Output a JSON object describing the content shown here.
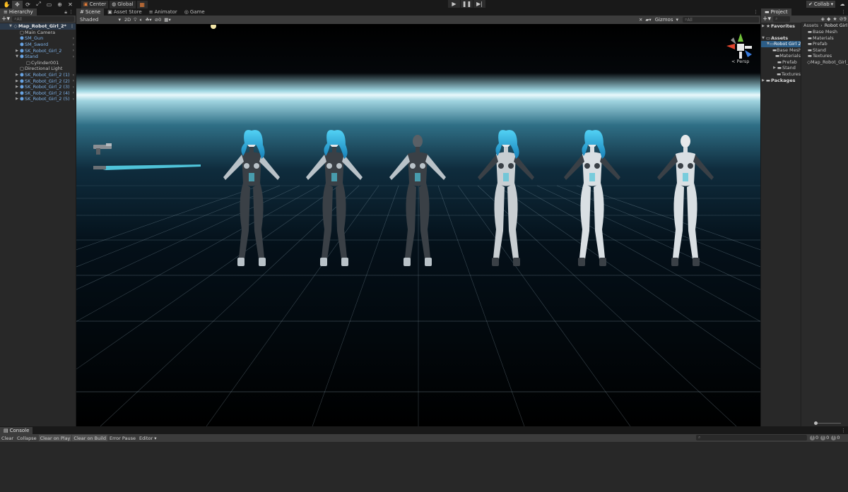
{
  "toolbar": {
    "center_label": "Center",
    "global_label": "Global",
    "collab_label": "Collab"
  },
  "hierarchy": {
    "tab_label": "Hierarchy",
    "search_placeholder": "All",
    "items": [
      {
        "label": "Map_Robot_Girl_2*",
        "depth": 0,
        "arrow": "▼",
        "icon": "scene",
        "prefab": false,
        "more": true,
        "root": true
      },
      {
        "label": "Main Camera",
        "depth": 1,
        "arrow": "",
        "icon": "object",
        "prefab": false,
        "more": false
      },
      {
        "label": "SM_Gun",
        "depth": 1,
        "arrow": "",
        "icon": "prefab",
        "prefab": true,
        "more": true
      },
      {
        "label": "SM_Sword",
        "depth": 1,
        "arrow": "",
        "icon": "prefab",
        "prefab": true,
        "more": true
      },
      {
        "label": "SK_Robot_Girl_2",
        "depth": 1,
        "arrow": "▶",
        "icon": "prefab",
        "prefab": true,
        "more": true
      },
      {
        "label": "Stand",
        "depth": 1,
        "arrow": "▼",
        "icon": "prefab",
        "prefab": true,
        "more": true
      },
      {
        "label": "Cylinder001",
        "depth": 2,
        "arrow": "",
        "icon": "object",
        "prefab": false,
        "more": false
      },
      {
        "label": "Directional Light",
        "depth": 1,
        "arrow": "",
        "icon": "object",
        "prefab": false,
        "more": false
      },
      {
        "label": "SK_Robot_Girl_2 (1)",
        "depth": 1,
        "arrow": "▶",
        "icon": "prefab",
        "prefab": true,
        "more": true
      },
      {
        "label": "SK_Robot_Girl_2 (2)",
        "depth": 1,
        "arrow": "▶",
        "icon": "prefab",
        "prefab": true,
        "more": true
      },
      {
        "label": "SK_Robot_Girl_2 (3)",
        "depth": 1,
        "arrow": "▶",
        "icon": "prefab",
        "prefab": true,
        "more": true
      },
      {
        "label": "SK_Robot_Girl_2 (4)",
        "depth": 1,
        "arrow": "▶",
        "icon": "prefab",
        "prefab": true,
        "more": true
      },
      {
        "label": "SK_Robot_Girl_2 (5)",
        "depth": 1,
        "arrow": "▶",
        "icon": "prefab",
        "prefab": true,
        "more": true
      }
    ]
  },
  "scene": {
    "tabs": [
      {
        "label": "Scene",
        "icon": "#",
        "active": true
      },
      {
        "label": "Asset Store",
        "icon": "▣",
        "active": false
      },
      {
        "label": "Animator",
        "icon": "≡",
        "active": false
      },
      {
        "label": "Game",
        "icon": "◎",
        "active": false
      }
    ],
    "shading_mode": "Shaded",
    "mode_2d": "2D",
    "hidden_count": "0",
    "gizmos_label": "Gizmos",
    "search_placeholder": "All",
    "persp_label": "< Persp",
    "sky_colors": {
      "top": "#000000",
      "horizon": "#cfeef5",
      "glow": "#5fb6c9",
      "floor": "#0a1a24"
    },
    "figures": [
      {
        "hair": "#29b6e6",
        "suit": "dark"
      },
      {
        "hair": "#29b6e6",
        "suit": "dark"
      },
      {
        "hair": "",
        "suit": "dark"
      },
      {
        "hair": "#29b6e6",
        "suit": "mixed"
      },
      {
        "hair": "#29b6e6",
        "suit": "light"
      },
      {
        "hair": "",
        "suit": "light"
      }
    ]
  },
  "project": {
    "tab_label": "Project",
    "favorites_label": "Favorites",
    "assets_label": "Assets",
    "packages_label": "Packages",
    "tree": [
      {
        "label": "Robot Girl 2",
        "depth": 1,
        "arrow": "▼",
        "selected": true
      },
      {
        "label": "Base Mesh",
        "depth": 2,
        "arrow": "",
        "selected": false
      },
      {
        "label": "Materials",
        "depth": 2,
        "arrow": "",
        "selected": false
      },
      {
        "label": "Prefab",
        "depth": 2,
        "arrow": "",
        "selected": false
      },
      {
        "label": "Stand",
        "depth": 2,
        "arrow": "▶",
        "selected": false
      },
      {
        "label": "Textures",
        "depth": 2,
        "arrow": "",
        "selected": false
      }
    ],
    "hidden_count": "9",
    "breadcrumb": [
      "Assets",
      "Robot Girl 2"
    ],
    "contents": [
      {
        "label": "Base Mesh",
        "icon": "folder"
      },
      {
        "label": "Materials",
        "icon": "folder"
      },
      {
        "label": "Prefab",
        "icon": "folder"
      },
      {
        "label": "Stand",
        "icon": "folder"
      },
      {
        "label": "Textures",
        "icon": "folder"
      },
      {
        "label": "Map_Robot_Girl_2",
        "icon": "scene"
      }
    ]
  },
  "console": {
    "tab_label": "Console",
    "buttons": [
      {
        "label": "Clear",
        "on": false
      },
      {
        "label": "Collapse",
        "on": false
      },
      {
        "label": "Clear on Play",
        "on": true
      },
      {
        "label": "Clear on Build",
        "on": true
      },
      {
        "label": "Error Pause",
        "on": false
      },
      {
        "label": "Editor ▾",
        "on": false
      }
    ],
    "log_count": "0",
    "warning_count": "0",
    "error_count": "0"
  }
}
